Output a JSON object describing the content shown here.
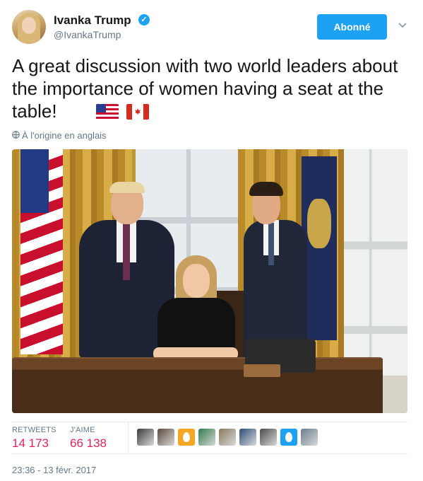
{
  "author": {
    "name": "Ivanka Trump",
    "handle": "@IvankaTrump",
    "verified_glyph": "✓"
  },
  "actions": {
    "follow_label": "Abonné",
    "menu_icon": "chevron-down-icon"
  },
  "tweet": {
    "text": "A great discussion with two world leaders about the importance of women having a seat at the table!",
    "flags": [
      "us-flag-icon",
      "canada-flag-icon"
    ],
    "translation_note": "À l'origine en anglais",
    "photo_description_icon": "photo"
  },
  "stats": {
    "retweets_label": "RETWEETS",
    "retweets_value": "14 173",
    "likes_label": "J'AIME",
    "likes_value": "66 138"
  },
  "likers": [
    {
      "type": "photo",
      "color": "#3b3b3b"
    },
    {
      "type": "photo",
      "color": "#5a4a3e"
    },
    {
      "type": "egg",
      "color": "#f5a623"
    },
    {
      "type": "photo",
      "color": "#2f7d4e"
    },
    {
      "type": "photo",
      "color": "#8a7a5e"
    },
    {
      "type": "photo",
      "color": "#2c4f79"
    },
    {
      "type": "photo",
      "color": "#4a4a4a"
    },
    {
      "type": "egg",
      "color": "#1da1f2"
    },
    {
      "type": "photo",
      "color": "#6b7d8f"
    }
  ],
  "timestamp": "23:36 - 13 févr. 2017",
  "colors": {
    "accent": "#1da1f2",
    "like": "#e0245e",
    "muted": "#657786"
  }
}
